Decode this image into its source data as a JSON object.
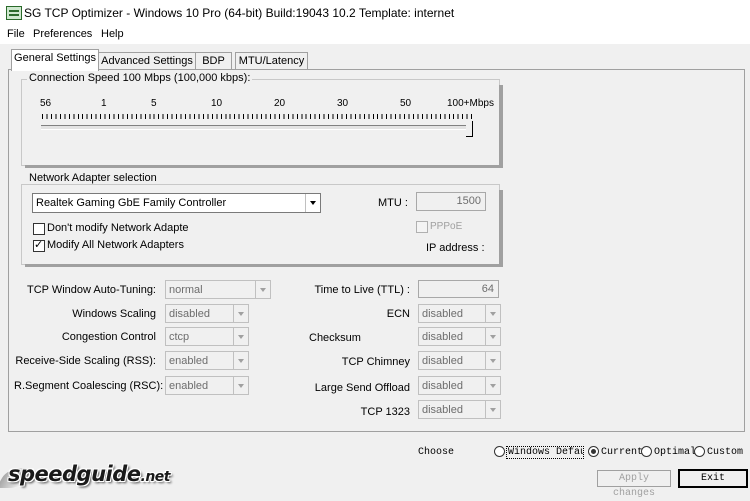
{
  "window": {
    "title": "SG TCP Optimizer - Windows 10 Pro (64-bit) Build:19043 10.2  Template: internet"
  },
  "menu": [
    "File",
    "Preferences",
    "Help"
  ],
  "tabs": [
    "General Settings",
    "Advanced Settings",
    "BDP",
    "MTU/Latency"
  ],
  "active_tab": 0,
  "connection_speed": {
    "label": "Connection Speed  100 Mbps (100,000 kbps):",
    "ticks": [
      "56",
      "1",
      "5",
      "10",
      "20",
      "30",
      "50",
      "100+Mbps"
    ],
    "value_fraction": 0.99
  },
  "adapter": {
    "group_label": "Network Adapter selection",
    "selected": "Realtek Gaming GbE Family Controller",
    "mtu_label": "MTU :",
    "mtu_value": "1500",
    "pppoe_label": "PPPoE",
    "ip_label": "IP address :",
    "dont_modify_label": "Don't modify Network Adapte",
    "modify_all_label": "Modify All Network Adapters",
    "dont_modify_checked": false,
    "modify_all_checked": true
  },
  "settings_left": [
    {
      "label": "TCP Window Auto-Tuning:",
      "value": "normal"
    },
    {
      "label": "Windows Scaling",
      "value": "disabled"
    },
    {
      "label": "Congestion Control",
      "value": "ctcp"
    },
    {
      "label": "Receive-Side Scaling (RSS):",
      "value": "enabled"
    },
    {
      "label": "R.Segment Coalescing (RSC):",
      "value": "enabled"
    }
  ],
  "settings_right": [
    {
      "label": "Time to Live (TTL) :",
      "value": "64"
    },
    {
      "label": "ECN",
      "value": "disabled"
    },
    {
      "label": "Checksum",
      "value": "disabled"
    },
    {
      "label": "TCP Chimney",
      "value": "disabled"
    },
    {
      "label": "Large Send Offload",
      "value": "disabled"
    },
    {
      "label": "TCP 1323",
      "value": "disabled"
    }
  ],
  "choose": {
    "label": "Choose",
    "options": [
      "Windows Default",
      "Current",
      "Optimal",
      "Custom"
    ],
    "selected": 1
  },
  "buttons": {
    "apply": "Apply changes",
    "exit": "Exit"
  },
  "logo": {
    "text": "speedguide",
    "suffix": ".net"
  }
}
